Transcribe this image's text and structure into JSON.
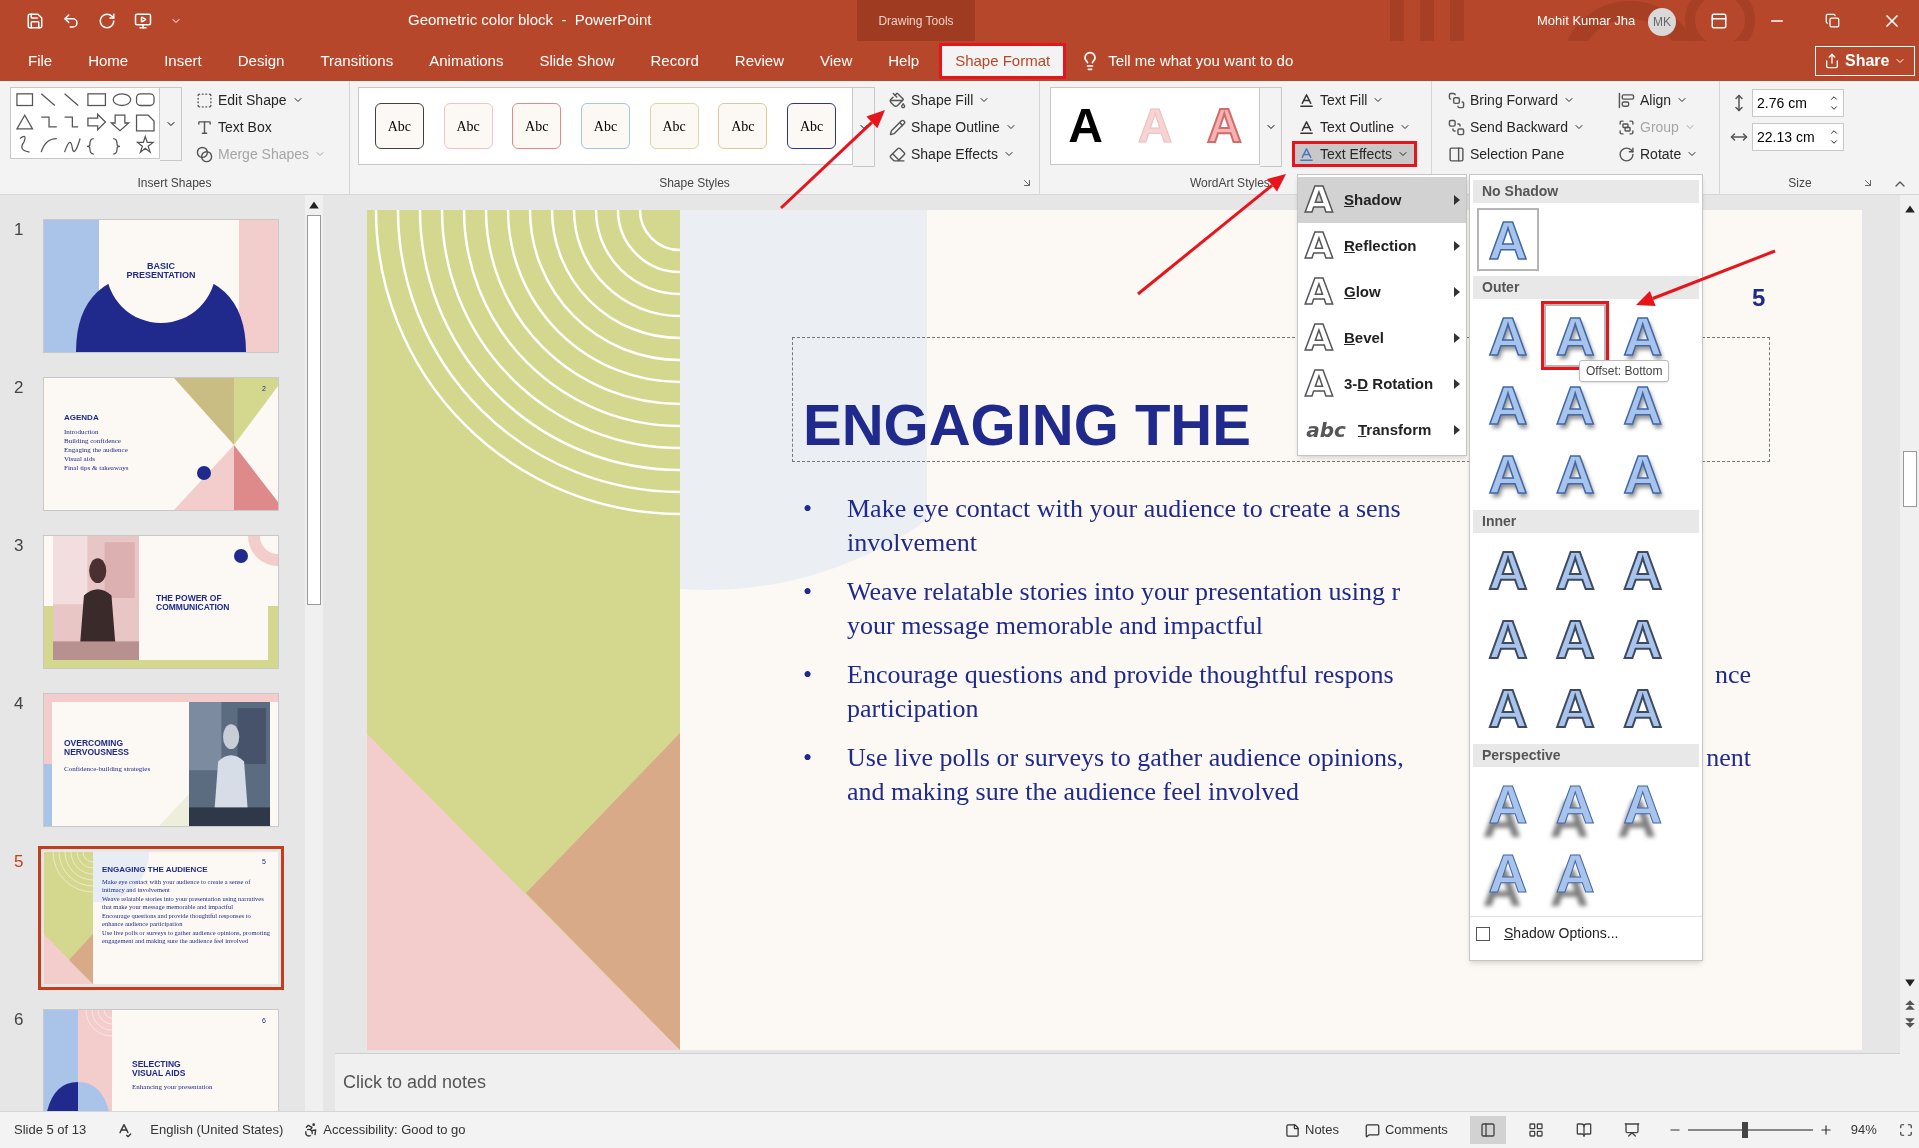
{
  "window": {
    "title": "Geometric color block  -  PowerPoint",
    "context_label": "Drawing Tools",
    "user": "Mohit Kumar Jha",
    "avatar": "MK"
  },
  "tabs": [
    {
      "label": "File",
      "selected": false,
      "highlighted": false
    },
    {
      "label": "Home",
      "selected": false,
      "highlighted": false
    },
    {
      "label": "Insert",
      "selected": false,
      "highlighted": false
    },
    {
      "label": "Design",
      "selected": false,
      "highlighted": false
    },
    {
      "label": "Transitions",
      "selected": false,
      "highlighted": false
    },
    {
      "label": "Animations",
      "selected": false,
      "highlighted": false
    },
    {
      "label": "Slide Show",
      "selected": false,
      "highlighted": false
    },
    {
      "label": "Record",
      "selected": false,
      "highlighted": false
    },
    {
      "label": "Review",
      "selected": false,
      "highlighted": false
    },
    {
      "label": "View",
      "selected": false,
      "highlighted": false
    },
    {
      "label": "Help",
      "selected": false,
      "highlighted": false
    },
    {
      "label": "Shape Format",
      "selected": true,
      "highlighted": true
    }
  ],
  "tell_me": {
    "placeholder": "Tell me what you want to do"
  },
  "share": "Share",
  "ribbon": {
    "insert_shapes": {
      "label": "Insert Shapes",
      "commands": [
        {
          "label": "Edit Shape",
          "disabled": false,
          "dropdown": true
        },
        {
          "label": "Text Box",
          "disabled": false,
          "dropdown": false
        },
        {
          "label": "Merge Shapes",
          "disabled": true,
          "dropdown": true
        }
      ]
    },
    "shape_styles": {
      "label": "Shape Styles",
      "swatches": [
        {
          "text": "Abc",
          "color": "#404040"
        },
        {
          "text": "Abc",
          "color": "#f2c4c4"
        },
        {
          "text": "Abc",
          "color": "#e08a8a"
        },
        {
          "text": "Abc",
          "color": "#a9c3ea"
        },
        {
          "text": "Abc",
          "color": "#d9d9a0"
        },
        {
          "text": "Abc",
          "color": "#d9caa0"
        },
        {
          "text": "Abc",
          "color": "#2b3599"
        }
      ],
      "commands": [
        {
          "label": "Shape Fill"
        },
        {
          "label": "Shape Outline"
        },
        {
          "label": "Shape Effects"
        }
      ]
    },
    "wordart": {
      "label": "WordArt Styles",
      "styles": [
        {
          "text": "A",
          "kind": "solid"
        },
        {
          "text": "A",
          "kind": "faded"
        },
        {
          "text": "A",
          "kind": "outline"
        }
      ],
      "commands": [
        {
          "label": "Text Fill",
          "highlighted": false
        },
        {
          "label": "Text Outline",
          "highlighted": false
        },
        {
          "label": "Text Effects",
          "highlighted": true
        }
      ]
    },
    "arrange": {
      "commands": [
        {
          "label": "Bring Forward",
          "disabled": false
        },
        {
          "label": "Send Backward",
          "disabled": false
        },
        {
          "label": "Selection Pane",
          "disabled": false
        },
        {
          "label": "Align",
          "disabled": false
        },
        {
          "label": "Group",
          "disabled": true
        },
        {
          "label": "Rotate",
          "disabled": false
        }
      ]
    },
    "size": {
      "label": "Size",
      "height": "2.76 cm",
      "width": "22.13 cm"
    }
  },
  "thumbnails": [
    {
      "number": "1",
      "kind": "title-arc",
      "selected": false,
      "title": [
        "BASIC",
        "PRESENTATION"
      ]
    },
    {
      "number": "2",
      "kind": "agenda",
      "selected": false,
      "page": "2",
      "title": [
        "AGENDA"
      ],
      "items": [
        "Introduction",
        "Building confidence",
        "Engaging the audience",
        "Visual aids",
        "Final tips & takeaways"
      ]
    },
    {
      "number": "3",
      "kind": "photo-left",
      "selected": false,
      "title": [
        "THE POWER OF",
        "COMMUNICATION"
      ]
    },
    {
      "number": "4",
      "kind": "photo-right",
      "selected": false,
      "title": [
        "OVERCOMING",
        "NERVOUSNESS"
      ],
      "subtitle": "Confidence-building strategies"
    },
    {
      "number": "5",
      "kind": "engaging",
      "selected": true,
      "page": "5",
      "title": [
        "ENGAGING THE AUDIENCE"
      ],
      "items": [
        "Make eye contact with your audience to create a sense of intimacy and involvement",
        "Weave relatable stories into your presentation using narratives that make your message memorable and impactful",
        "Encourage questions and provide thoughtful responses to enhance audience participation",
        "Use live polls or surveys to gather audience opinions, promoting engagement and making sure the audience feel involved"
      ]
    },
    {
      "number": "6",
      "kind": "visual-aids",
      "selected": false,
      "page": "6",
      "title": [
        "SELECTING",
        "VISUAL AIDS"
      ],
      "subtitle": "Enhancing your presentation"
    }
  ],
  "slide": {
    "number": "5",
    "title": "ENGAGING THE",
    "bullets": [
      {
        "lines": [
          {
            "text": "Make eye contact with your audience to create a sens"
          },
          {
            "text": "involvement"
          }
        ]
      },
      {
        "lines": [
          {
            "text": "Weave relatable stories into your presentation using r"
          },
          {
            "text": "your message memorable and impactful"
          }
        ]
      },
      {
        "lines": [
          {
            "text": "Encourage questions and provide thoughtful respons",
            "tail": "nce"
          },
          {
            "text": "participation"
          }
        ]
      },
      {
        "lines": [
          {
            "text": "Use live polls or surveys to gather audience opinions,",
            "tail": "nent"
          },
          {
            "text": "and making sure the audience feel involved"
          }
        ]
      }
    ],
    "bullet": "•"
  },
  "notes": {
    "placeholder": "Click to add notes"
  },
  "text_effects_menu": [
    {
      "glyph": "A",
      "accel": "S",
      "rest": "hadow",
      "selected": true
    },
    {
      "glyph": "A",
      "accel": "R",
      "rest": "eflection",
      "selected": false
    },
    {
      "glyph": "A",
      "accel": "G",
      "rest": "low",
      "selected": false
    },
    {
      "glyph": "A",
      "accel": "B",
      "rest": "evel",
      "selected": false
    },
    {
      "glyph": "A",
      "pre": "3-",
      "accel": "D",
      "rest": " Rotation",
      "selected": false
    },
    {
      "glyph": "abc",
      "accel": "T",
      "rest": "ransform",
      "selected": false
    }
  ],
  "shadow_gallery": {
    "sections": [
      {
        "heading": "No Shadow",
        "kind": "none",
        "items": [
          {
            "glyph": "A",
            "framed": true,
            "highlighted": false
          }
        ]
      },
      {
        "heading": "Outer",
        "kind": "outer",
        "items": [
          {
            "glyph": "A",
            "framed": false,
            "highlighted": false
          },
          {
            "glyph": "A",
            "framed": true,
            "highlighted": true
          },
          {
            "glyph": "A",
            "framed": false,
            "highlighted": false
          },
          {
            "glyph": "A",
            "framed": false,
            "highlighted": false
          },
          {
            "glyph": "A",
            "framed": false,
            "highlighted": false
          },
          {
            "glyph": "A",
            "framed": false,
            "highlighted": false
          },
          {
            "glyph": "A",
            "framed": false,
            "highlighted": false
          },
          {
            "glyph": "A",
            "framed": false,
            "highlighted": false
          },
          {
            "glyph": "A",
            "framed": false,
            "highlighted": false
          }
        ]
      },
      {
        "heading": "Inner",
        "kind": "inner",
        "items": [
          {
            "glyph": "A",
            "framed": false,
            "highlighted": false
          },
          {
            "glyph": "A",
            "framed": false,
            "highlighted": false
          },
          {
            "glyph": "A",
            "framed": false,
            "highlighted": false
          },
          {
            "glyph": "A",
            "framed": false,
            "highlighted": false
          },
          {
            "glyph": "A",
            "framed": false,
            "highlighted": false
          },
          {
            "glyph": "A",
            "framed": false,
            "highlighted": false
          },
          {
            "glyph": "A",
            "framed": false,
            "highlighted": false
          },
          {
            "glyph": "A",
            "framed": false,
            "highlighted": false
          },
          {
            "glyph": "A",
            "framed": false,
            "highlighted": false
          }
        ]
      },
      {
        "heading": "Perspective",
        "kind": "perspective",
        "items": [
          {
            "glyph": "A",
            "framed": false,
            "highlighted": false
          },
          {
            "glyph": "A",
            "framed": false,
            "highlighted": false
          },
          {
            "glyph": "A",
            "framed": false,
            "highlighted": false
          },
          {
            "glyph": "A",
            "framed": false,
            "highlighted": false
          },
          {
            "glyph": "A",
            "framed": false,
            "highlighted": false
          }
        ]
      }
    ],
    "tooltip": "Offset: Bottom",
    "options": {
      "accel": "S",
      "rest": "hadow Options...",
      "checked": false
    }
  },
  "status_bar": {
    "slide": "Slide 5 of 13",
    "language": "English (United States)",
    "accessibility": "Accessibility: Good to go",
    "notes": "Notes",
    "comments": "Comments",
    "views": [
      {
        "kind": "normal",
        "selected": true
      },
      {
        "kind": "sorter",
        "selected": false
      },
      {
        "kind": "reading",
        "selected": false
      },
      {
        "kind": "show",
        "selected": false
      }
    ],
    "zoom": {
      "reading": "94%",
      "level": 0.46
    }
  }
}
